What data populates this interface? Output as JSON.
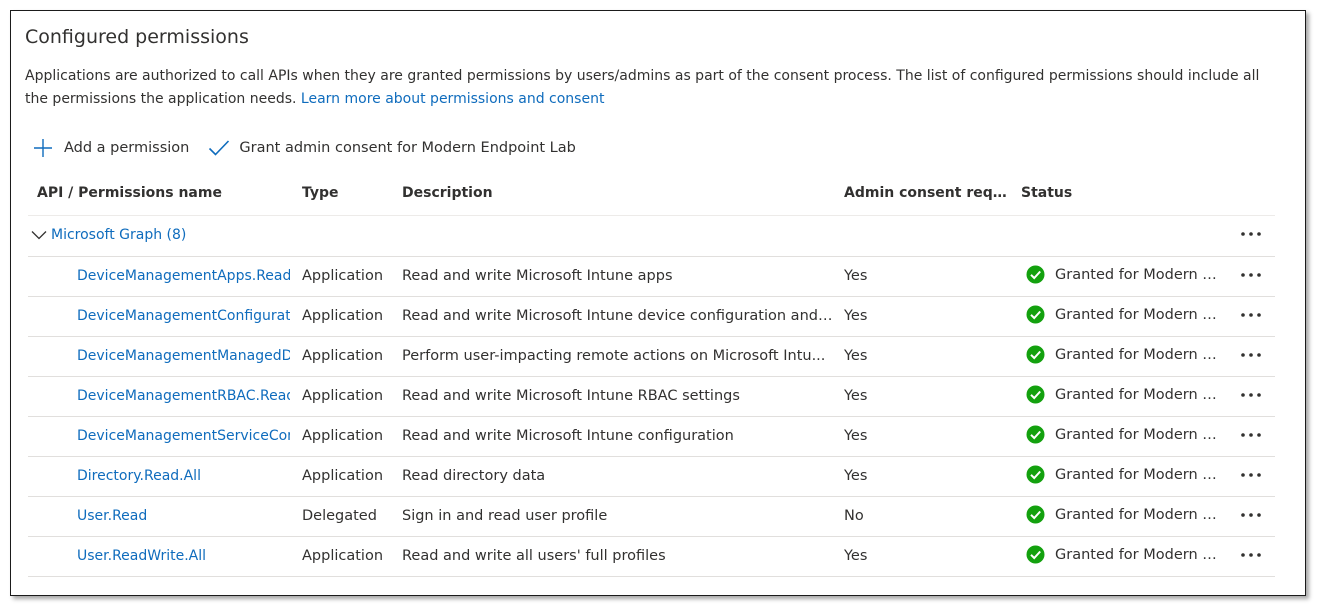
{
  "section": {
    "title": "Configured permissions",
    "description": "Applications are authorized to call APIs when they are granted permissions by users/admins as part of the consent process. The list of configured permissions should include all the permissions the application needs.",
    "learn_more_link": "Learn more about permissions and consent"
  },
  "toolbar": {
    "add_permission_label": "Add a permission",
    "grant_consent_label": "Grant admin consent for Modern Endpoint Lab"
  },
  "table": {
    "columns": [
      "API / Permissions name",
      "Type",
      "Description",
      "Admin consent requ...",
      "Status"
    ],
    "group": {
      "label": "Microsoft Graph (8)"
    },
    "rows": [
      {
        "name": "DeviceManagementApps.ReadW",
        "type": "Application",
        "description": "Read and write Microsoft Intune apps",
        "admin_consent": "Yes",
        "status": "Granted for Modern En..."
      },
      {
        "name": "DeviceManagementConfiguratic",
        "type": "Application",
        "description": "Read and write Microsoft Intune device configuration and ...",
        "admin_consent": "Yes",
        "status": "Granted for Modern En..."
      },
      {
        "name": "DeviceManagementManagedDe",
        "type": "Application",
        "description": "Perform user-impacting remote actions on Microsoft Intu...",
        "admin_consent": "Yes",
        "status": "Granted for Modern En..."
      },
      {
        "name": "DeviceManagementRBAC.ReadV",
        "type": "Application",
        "description": "Read and write Microsoft Intune RBAC settings",
        "admin_consent": "Yes",
        "status": "Granted for Modern En..."
      },
      {
        "name": "DeviceManagementServiceConfi",
        "type": "Application",
        "description": "Read and write Microsoft Intune configuration",
        "admin_consent": "Yes",
        "status": "Granted for Modern En..."
      },
      {
        "name": "Directory.Read.All",
        "type": "Application",
        "description": "Read directory data",
        "admin_consent": "Yes",
        "status": "Granted for Modern En..."
      },
      {
        "name": "User.Read",
        "type": "Delegated",
        "description": "Sign in and read user profile",
        "admin_consent": "No",
        "status": "Granted for Modern En..."
      },
      {
        "name": "User.ReadWrite.All",
        "type": "Application",
        "description": "Read and write all users' full profiles",
        "admin_consent": "Yes",
        "status": "Granted for Modern En..."
      }
    ]
  },
  "icons": {
    "add": "plus-icon",
    "grant": "checkmark-icon",
    "expand": "chevron-down-icon",
    "status": "check-circle-icon",
    "more": "more-icon"
  },
  "colors": {
    "link": "#0f6cbd",
    "success": "#13a10e",
    "text": "#323130",
    "divider": "#e1dfdd"
  }
}
